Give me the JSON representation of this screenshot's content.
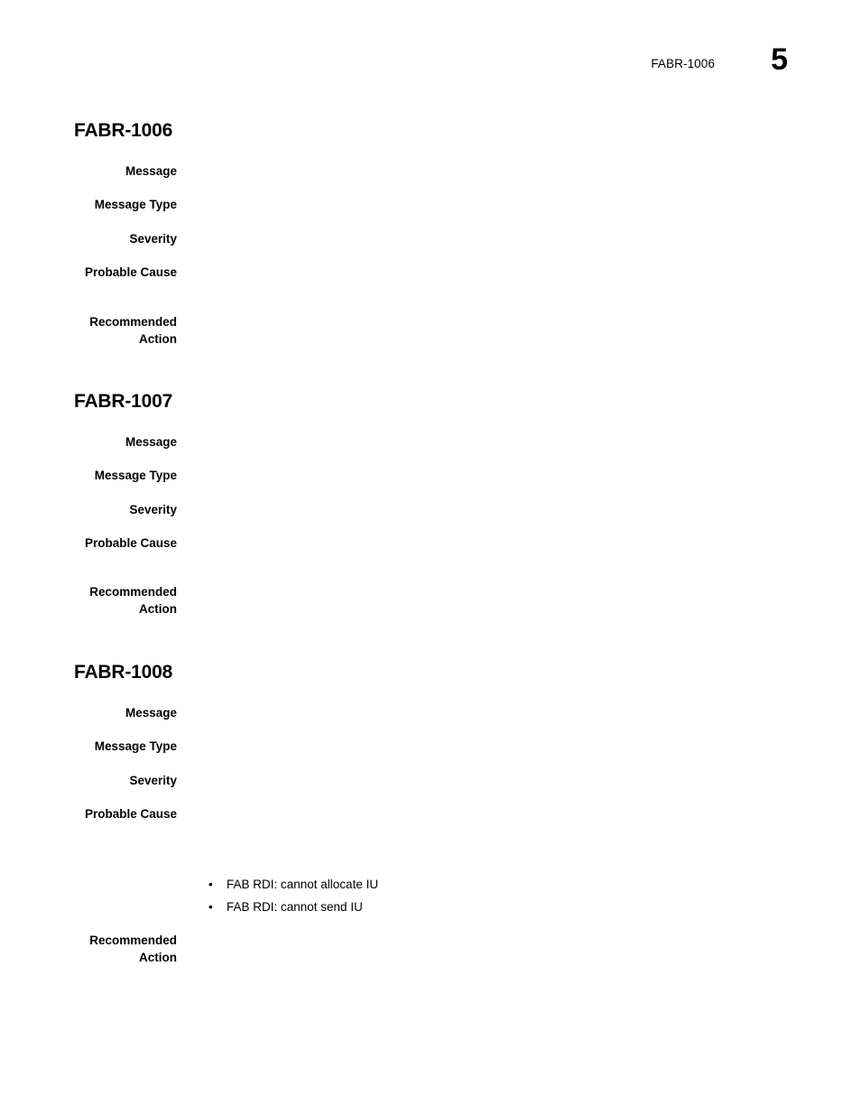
{
  "header": {
    "running_head": "FABR-1006",
    "page_number": "5"
  },
  "sections": [
    {
      "heading": "FABR-1006",
      "fields": [
        {
          "label": "Message",
          "value": ""
        },
        {
          "label": "Message Type",
          "value": ""
        },
        {
          "label": "Severity",
          "value": ""
        },
        {
          "label": "Probable Cause",
          "value": ""
        },
        {
          "label": "Recommended\nAction",
          "value": ""
        }
      ]
    },
    {
      "heading": "FABR-1007",
      "fields": [
        {
          "label": "Message",
          "value": ""
        },
        {
          "label": "Message Type",
          "value": ""
        },
        {
          "label": "Severity",
          "value": ""
        },
        {
          "label": "Probable Cause",
          "value": ""
        },
        {
          "label": "Recommended\nAction",
          "value": ""
        }
      ]
    },
    {
      "heading": "FABR-1008",
      "fields": [
        {
          "label": "Message",
          "value": ""
        },
        {
          "label": "Message Type",
          "value": ""
        },
        {
          "label": "Severity",
          "value": ""
        },
        {
          "label": "Probable Cause",
          "value": ""
        },
        {
          "label": "Recommended\nAction",
          "value": ""
        }
      ],
      "bullets": [
        {
          "marker": "•",
          "text": "FAB RDI: cannot allocate IU"
        },
        {
          "marker": "•",
          "text": "FAB RDI: cannot send IU"
        }
      ]
    }
  ]
}
